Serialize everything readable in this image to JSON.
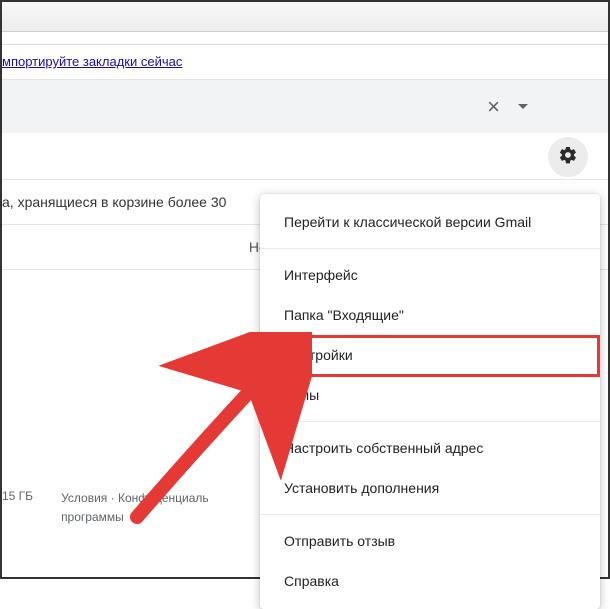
{
  "bookmarks": {
    "import_link": "мпортируйте закладки сейчас"
  },
  "notice": {
    "text": "а, хранящиеся в корзине более 30"
  },
  "empty": {
    "text": "Нет сообщений в"
  },
  "footer": {
    "storage": "15 ГБ",
    "terms": "Условия",
    "dot": " · ",
    "privacy_line1": "Конфиденциаль",
    "privacy_line2": "программы"
  },
  "menu": {
    "classic": "Перейти к классической версии Gmail",
    "interface": "Интерфейс",
    "inbox": "Папка \"Входящие\"",
    "settings": "Настройки",
    "themes": "Темы",
    "own_address": "Настроить собственный адрес",
    "addons": "Установить дополнения",
    "feedback": "Отправить отзыв",
    "help": "Справка"
  }
}
